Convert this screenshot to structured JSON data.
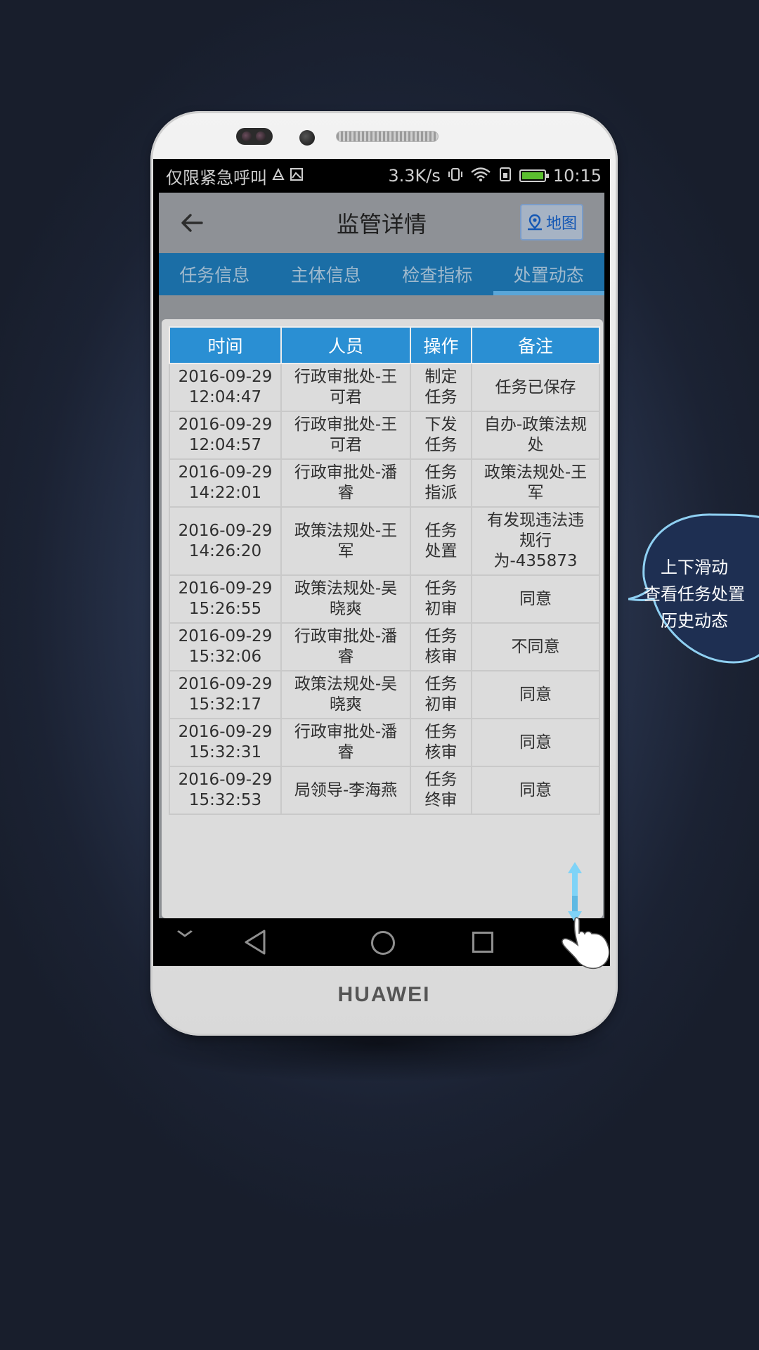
{
  "device": {
    "brand": "HUAWEI"
  },
  "status_bar": {
    "carrier": "仅限紧急呼叫",
    "speed": "3.3K/s",
    "time": "10:15"
  },
  "header": {
    "title": "监管详情",
    "map_label": "地图"
  },
  "tabs": [
    {
      "label": "任务信息",
      "active": false
    },
    {
      "label": "主体信息",
      "active": false
    },
    {
      "label": "检查指标",
      "active": false
    },
    {
      "label": "处置动态",
      "active": true
    }
  ],
  "table": {
    "columns": [
      "时间",
      "人员",
      "操作",
      "备注"
    ],
    "rows": [
      {
        "time": "2016-09-29\n12:04:47",
        "person": "行政审批处-王\n可君",
        "op": "制定\n任务",
        "note": "任务已保存"
      },
      {
        "time": "2016-09-29\n12:04:57",
        "person": "行政审批处-王\n可君",
        "op": "下发\n任务",
        "note": "自办-政策法规\n处"
      },
      {
        "time": "2016-09-29\n14:22:01",
        "person": "行政审批处-潘\n睿",
        "op": "任务\n指派",
        "note": "政策法规处-王\n军"
      },
      {
        "time": "2016-09-29\n14:26:20",
        "person": "政策法规处-王\n军",
        "op": "任务\n处置",
        "note": "有发现违法违\n规行\n为-435873"
      },
      {
        "time": "2016-09-29\n15:26:55",
        "person": "政策法规处-吴\n晓爽",
        "op": "任务\n初审",
        "note": "同意"
      },
      {
        "time": "2016-09-29\n15:32:06",
        "person": "行政审批处-潘\n睿",
        "op": "任务\n核审",
        "note": "不同意"
      },
      {
        "time": "2016-09-29\n15:32:17",
        "person": "政策法规处-吴\n晓爽",
        "op": "任务\n初审",
        "note": "同意"
      },
      {
        "time": "2016-09-29\n15:32:31",
        "person": "行政审批处-潘\n睿",
        "op": "任务\n核审",
        "note": "同意"
      },
      {
        "time": "2016-09-29\n15:32:53",
        "person": "局领导-李海燕",
        "op": "任务\n终审",
        "note": "同意"
      }
    ]
  },
  "callout": {
    "lines": [
      "上下滑动",
      "查看任务处置",
      "历史动态"
    ]
  },
  "colors": {
    "header_bg": "#8e9196",
    "tab_bar": "#1b6ea6",
    "table_header": "#2a8fd3",
    "callout_fill": "#1e2f52",
    "callout_stroke": "#8fd0f2",
    "swipe_arrow": "#7fd3f7"
  }
}
